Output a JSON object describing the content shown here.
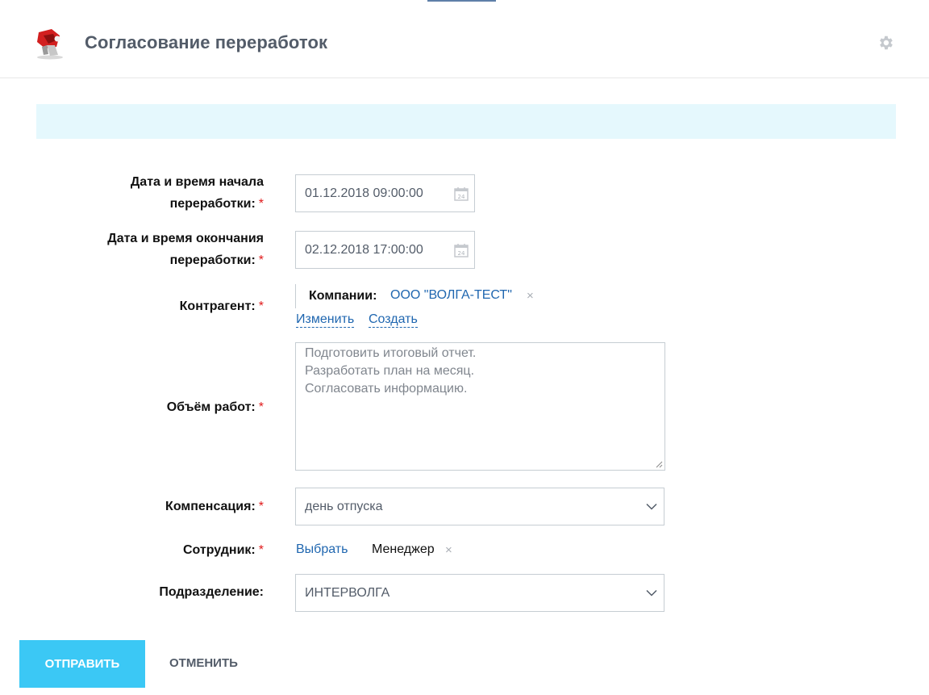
{
  "header": {
    "title": "Согласование переработок",
    "logo_icon": "red-mascot-logo-icon",
    "settings_icon": "gear-icon"
  },
  "form": {
    "start": {
      "label_line1": "Дата и время начала",
      "label_line2": "переработки:",
      "required": "*",
      "value": "01.12.2018 09:00:00"
    },
    "end": {
      "label_line1": "Дата и время окончания",
      "label_line2": "переработки:",
      "required": "*",
      "value": "02.12.2018 17:00:00"
    },
    "contractor": {
      "label": "Контрагент:",
      "required": "*",
      "companies_label": "Компании:",
      "company_value": "ООО \"ВОЛГА-ТЕСТ\"",
      "remove": "×",
      "change_link": "Изменить",
      "create_link": "Создать"
    },
    "scope": {
      "label": "Объём работ:",
      "required": "*",
      "value": "Подготовить итоговый отчет.\nРазработать план на месяц.\nСогласовать информацию."
    },
    "compensation": {
      "label": "Компенсация:",
      "required": "*",
      "value": "день отпуска"
    },
    "employee": {
      "label": "Сотрудник:",
      "required": "*",
      "select_link": "Выбрать",
      "value": "Менеджер",
      "remove": "×"
    },
    "department": {
      "label": "Подразделение:",
      "value": "ИНТЕРВОЛГА"
    }
  },
  "actions": {
    "submit": "ОТПРАВИТЬ",
    "cancel": "ОТМЕНИТЬ"
  },
  "colors": {
    "accent_button": "#3bc8f5",
    "link": "#2067b0",
    "required": "#e0191a",
    "notice_bg": "#e5f8fd"
  }
}
